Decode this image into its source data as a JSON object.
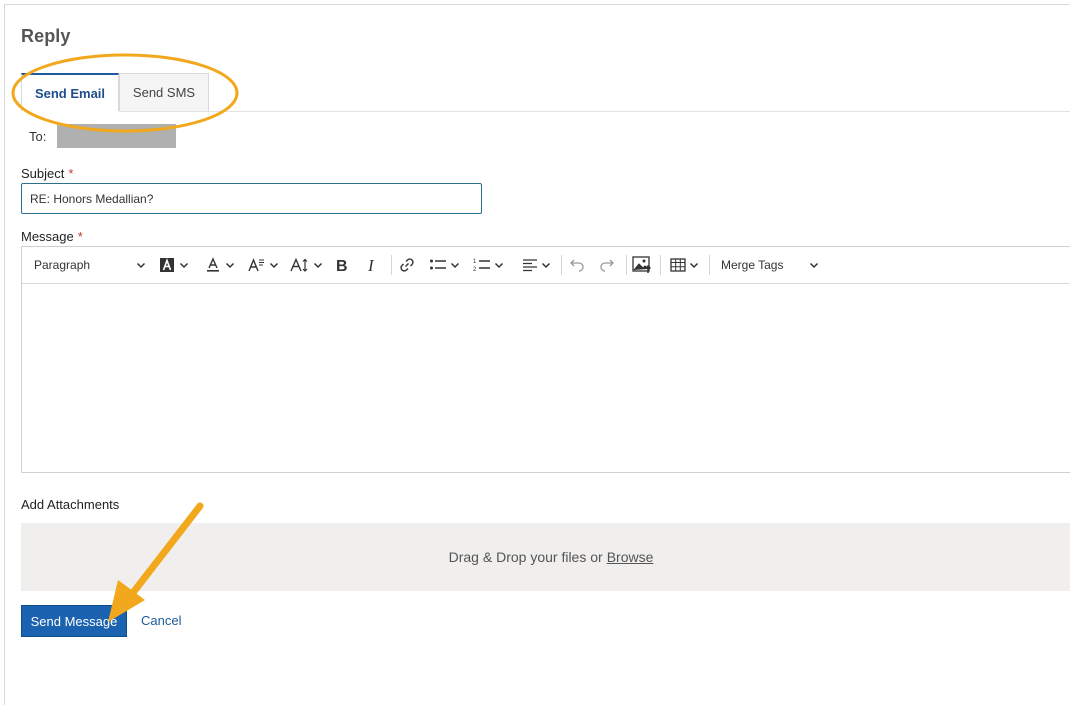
{
  "page": {
    "title": "Reply"
  },
  "tabs": [
    {
      "label": "Send Email",
      "active": true
    },
    {
      "label": "Send SMS",
      "active": false
    }
  ],
  "to": {
    "label": "To:"
  },
  "subject": {
    "label": "Subject",
    "required_mark": "*",
    "value": "RE: Honors Medallian?"
  },
  "message": {
    "label": "Message",
    "required_mark": "*"
  },
  "toolbar": {
    "block_format": "Paragraph",
    "merge_tags": "Merge Tags",
    "icons": [
      "highlight-icon",
      "font-color-icon",
      "font-family-icon",
      "font-size-icon",
      "bold-icon",
      "italic-icon",
      "link-icon",
      "bullet-list-icon",
      "numbered-list-icon",
      "align-icon",
      "undo-icon",
      "redo-icon",
      "insert-image-icon",
      "table-icon"
    ]
  },
  "attachments": {
    "label": "Add Attachments",
    "drop_text": "Drag & Drop your files or",
    "browse_text": "Browse"
  },
  "actions": {
    "send_label": "Send Message",
    "cancel_label": "Cancel"
  },
  "colors": {
    "accent": "#1b62b0",
    "annotation": "#f2a81d"
  }
}
